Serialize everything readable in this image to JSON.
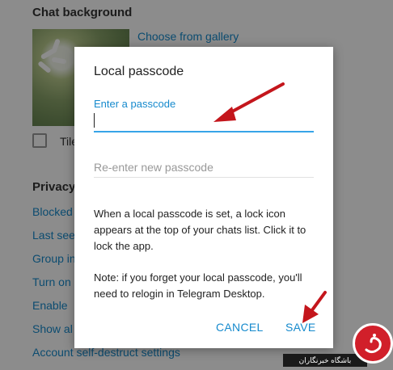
{
  "background": {
    "chat_background_title": "Chat background",
    "choose_gallery": "Choose from gallery",
    "tile_label": "Tile",
    "privacy_title": "Privacy",
    "items": [
      "Blocked",
      "Last seen",
      "Group in",
      "Turn on",
      "Enable",
      "Show al",
      "Account self-destruct settings"
    ]
  },
  "dialog": {
    "title": "Local passcode",
    "field_label": "Enter a passcode",
    "reenter_placeholder": "Re-enter new passcode",
    "description1": "When a local passcode is set, a lock icon appears at the top of your chats list. Click it to lock the app.",
    "description2": "Note: if you forget your local passcode, you'll need to relogin in Telegram Desktop.",
    "cancel": "CANCEL",
    "save": "SAVE"
  },
  "watermark": {
    "text": "باشگاه خبرنگاران"
  },
  "colors": {
    "accent": "#168acd",
    "arrow": "#c4161c"
  }
}
